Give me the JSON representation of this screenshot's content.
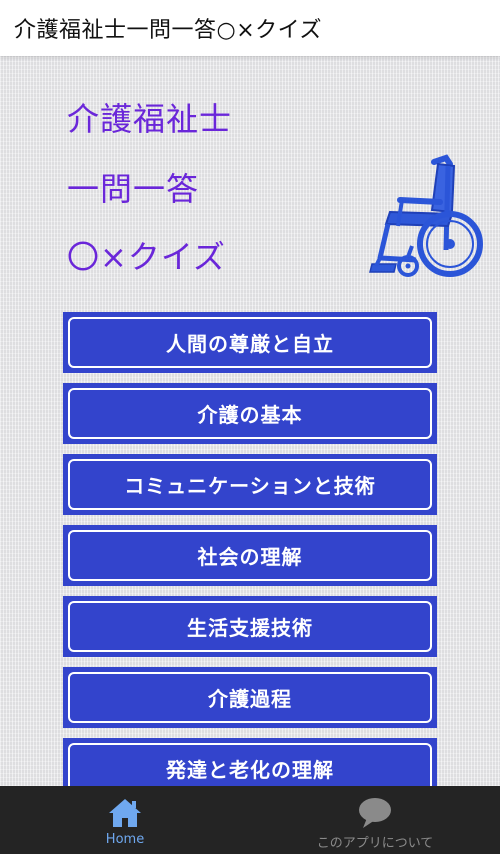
{
  "appbar": {
    "title": "介護福祉士一問一答○×クイズ"
  },
  "hero": {
    "line1": "介護福祉士",
    "line2": "一問一答",
    "line3": "〇×クイズ",
    "color": "#6a26d9",
    "image_icon": "wheelchair-icon"
  },
  "menu": {
    "button_color": "#3344cc",
    "items": [
      {
        "label": "人間の尊厳と自立"
      },
      {
        "label": "介護の基本"
      },
      {
        "label": "コミュニケーションと技術"
      },
      {
        "label": "社会の理解"
      },
      {
        "label": "生活支援技術"
      },
      {
        "label": "介護過程"
      },
      {
        "label": "発達と老化の理解"
      }
    ]
  },
  "bottom_nav": {
    "items": [
      {
        "label": "Home",
        "icon": "home-icon",
        "active": true,
        "color": "#6fa8ef"
      },
      {
        "label": "このアプリについて",
        "icon": "speech-bubble-icon",
        "active": false,
        "color": "#8a8a8a"
      }
    ]
  }
}
